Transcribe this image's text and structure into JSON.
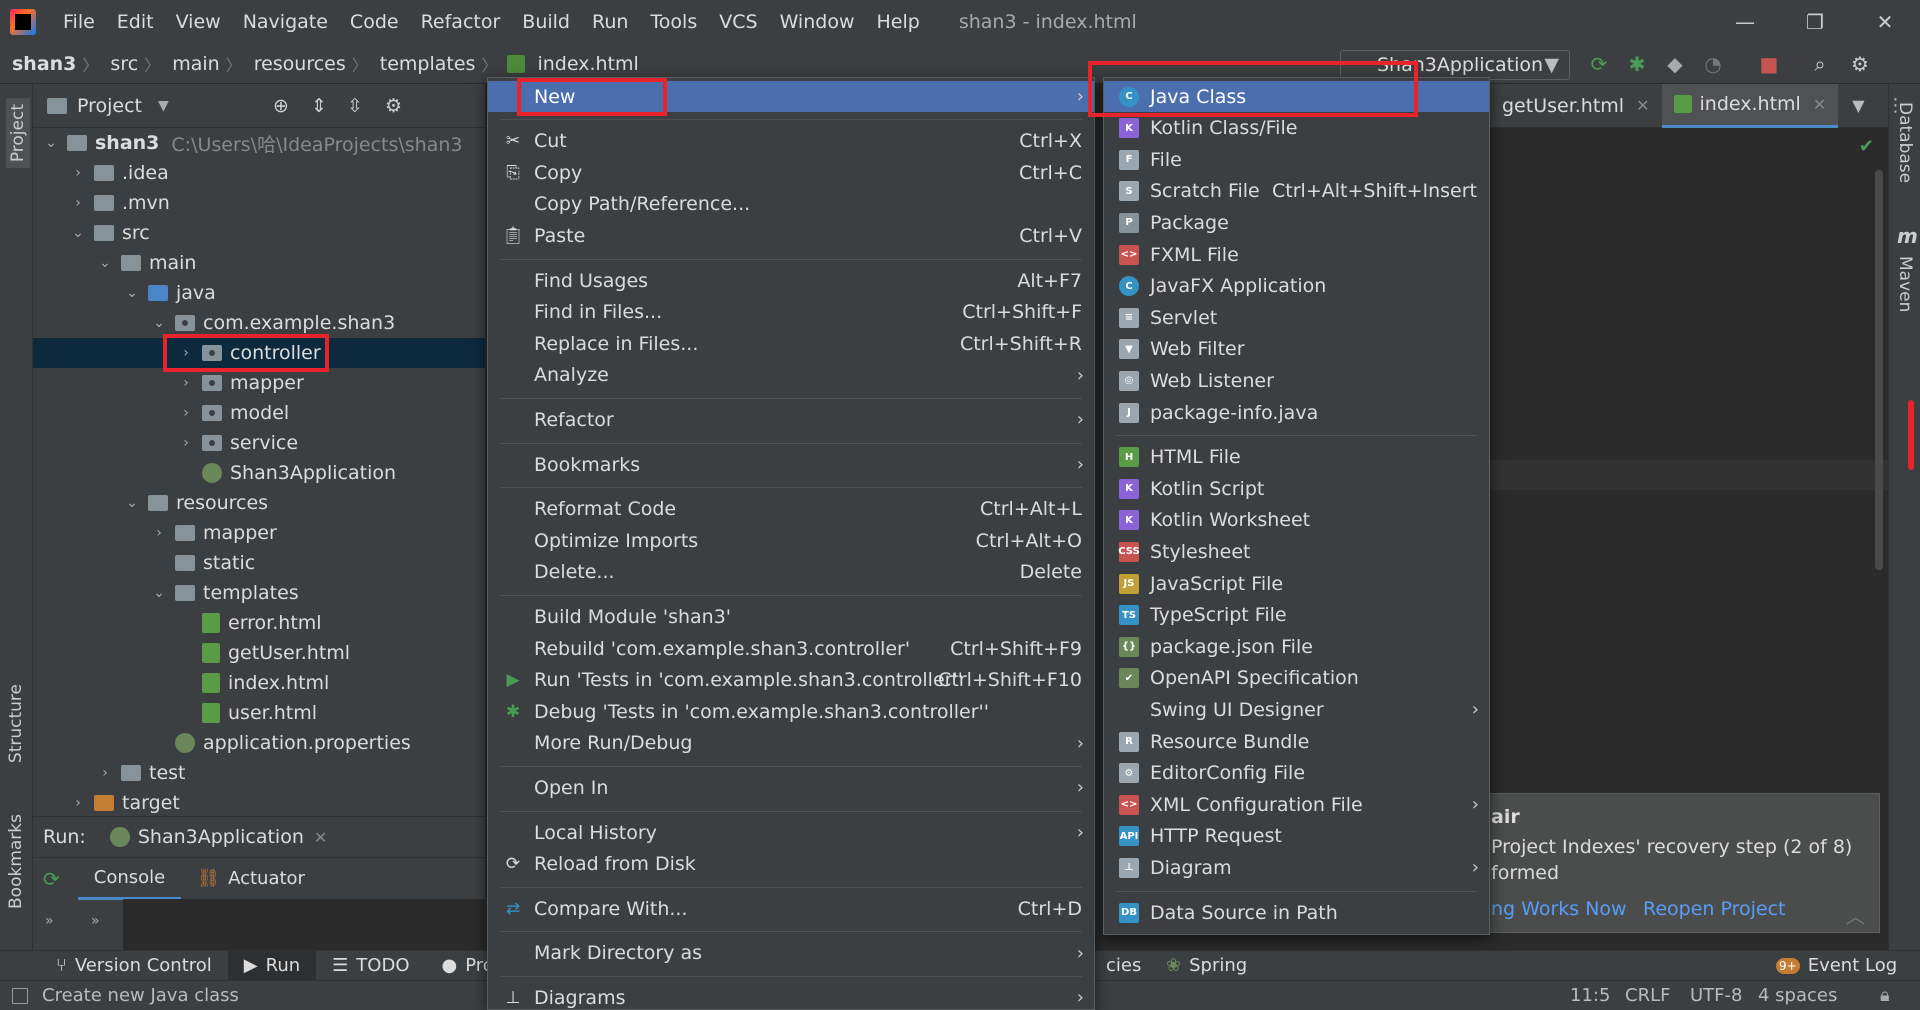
{
  "window": {
    "title": "shan3 - index.html",
    "menu": [
      "File",
      "Edit",
      "View",
      "Navigate",
      "Code",
      "Refactor",
      "Build",
      "Run",
      "Tools",
      "VCS",
      "Window",
      "Help"
    ],
    "minimize": "—",
    "restore": "❐",
    "close": "✕"
  },
  "breadcrumb": [
    "shan3",
    "src",
    "main",
    "resources",
    "templates",
    "index.html"
  ],
  "toolbar": {
    "run_config": "Shan3Application"
  },
  "left_strip": {
    "project": "Project",
    "structure": "Structure",
    "bookmarks": "Bookmarks"
  },
  "right_strip": {
    "database": "Database",
    "maven": "Maven",
    "maven_icon": "m"
  },
  "project_panel": {
    "title": "Project",
    "tree": [
      {
        "label": "shan3",
        "hint": "C:\\Users\\哈\\IdeaProjects\\shan3",
        "indent": 0,
        "chev": "down",
        "icon": "folder"
      },
      {
        "label": ".idea",
        "indent": 1,
        "chev": "right",
        "icon": "folder"
      },
      {
        "label": ".mvn",
        "indent": 1,
        "chev": "right",
        "icon": "folder"
      },
      {
        "label": "src",
        "indent": 1,
        "chev": "down",
        "icon": "folder"
      },
      {
        "label": "main",
        "indent": 2,
        "chev": "down",
        "icon": "folder"
      },
      {
        "label": "java",
        "indent": 3,
        "chev": "down",
        "icon": "folder-blue"
      },
      {
        "label": "com.example.shan3",
        "indent": 4,
        "chev": "down",
        "icon": "package"
      },
      {
        "label": "controller",
        "indent": 5,
        "chev": "right",
        "icon": "package",
        "selected": true
      },
      {
        "label": "mapper",
        "indent": 5,
        "chev": "right",
        "icon": "package"
      },
      {
        "label": "model",
        "indent": 5,
        "chev": "right",
        "icon": "package"
      },
      {
        "label": "service",
        "indent": 5,
        "chev": "right",
        "icon": "package"
      },
      {
        "label": "Shan3Application",
        "indent": 5,
        "chev": "",
        "icon": "spring"
      },
      {
        "label": "resources",
        "indent": 3,
        "chev": "down",
        "icon": "folder"
      },
      {
        "label": "mapper",
        "indent": 4,
        "chev": "right",
        "icon": "folder"
      },
      {
        "label": "static",
        "indent": 4,
        "chev": "",
        "icon": "folder"
      },
      {
        "label": "templates",
        "indent": 4,
        "chev": "down",
        "icon": "folder"
      },
      {
        "label": "error.html",
        "indent": 5,
        "chev": "",
        "icon": "html"
      },
      {
        "label": "getUser.html",
        "indent": 5,
        "chev": "",
        "icon": "html"
      },
      {
        "label": "index.html",
        "indent": 5,
        "chev": "",
        "icon": "html"
      },
      {
        "label": "user.html",
        "indent": 5,
        "chev": "",
        "icon": "html"
      },
      {
        "label": "application.properties",
        "indent": 4,
        "chev": "",
        "icon": "spring"
      },
      {
        "label": "test",
        "indent": 2,
        "chev": "right",
        "icon": "folder"
      },
      {
        "label": "target",
        "indent": 1,
        "chev": "right",
        "icon": "folder-orange"
      }
    ]
  },
  "editor_tabs": [
    {
      "label": "getUser.html",
      "active": false
    },
    {
      "label": "index.html",
      "active": true
    }
  ],
  "notification": {
    "title": "air",
    "line1": "Project Indexes' recovery step (2 of 8)",
    "line2": "formed",
    "link1": "ng Works Now",
    "link2": "Reopen Project"
  },
  "run_panel": {
    "label": "Run:",
    "config": "Shan3Application",
    "tabs": [
      "Console",
      "Actuator"
    ]
  },
  "context_menu": {
    "items": [
      {
        "label": "New",
        "shortcut": "",
        "submenu": true,
        "highlighted": true,
        "icon": ""
      },
      {
        "sep": true
      },
      {
        "label": "Cut",
        "shortcut": "Ctrl+X",
        "icon": "scissors-icon"
      },
      {
        "label": "Copy",
        "shortcut": "Ctrl+C",
        "icon": "copy-icon"
      },
      {
        "label": "Copy Path/Reference...",
        "shortcut": "",
        "icon": ""
      },
      {
        "label": "Paste",
        "shortcut": "Ctrl+V",
        "icon": "paste-icon"
      },
      {
        "sep": true
      },
      {
        "label": "Find Usages",
        "shortcut": "Alt+F7",
        "icon": ""
      },
      {
        "label": "Find in Files...",
        "shortcut": "Ctrl+Shift+F",
        "icon": ""
      },
      {
        "label": "Replace in Files...",
        "shortcut": "Ctrl+Shift+R",
        "icon": ""
      },
      {
        "label": "Analyze",
        "submenu": true,
        "icon": ""
      },
      {
        "sep": true
      },
      {
        "label": "Refactor",
        "submenu": true,
        "icon": ""
      },
      {
        "sep": true
      },
      {
        "label": "Bookmarks",
        "submenu": true,
        "icon": ""
      },
      {
        "sep": true
      },
      {
        "label": "Reformat Code",
        "shortcut": "Ctrl+Alt+L",
        "icon": ""
      },
      {
        "label": "Optimize Imports",
        "shortcut": "Ctrl+Alt+O",
        "icon": ""
      },
      {
        "label": "Delete...",
        "shortcut": "Delete",
        "icon": ""
      },
      {
        "sep": true
      },
      {
        "label": "Build Module 'shan3'",
        "shortcut": "",
        "icon": ""
      },
      {
        "label": "Rebuild 'com.example.shan3.controller'",
        "shortcut": "Ctrl+Shift+F9",
        "icon": ""
      },
      {
        "label": "Run 'Tests in 'com.example.shan3.controller''",
        "shortcut": "Ctrl+Shift+F10",
        "icon": "run-icon"
      },
      {
        "label": "Debug 'Tests in 'com.example.shan3.controller''",
        "shortcut": "",
        "icon": "debug-icon"
      },
      {
        "label": "More Run/Debug",
        "submenu": true,
        "icon": ""
      },
      {
        "sep": true
      },
      {
        "label": "Open In",
        "submenu": true,
        "icon": ""
      },
      {
        "sep": true
      },
      {
        "label": "Local History",
        "submenu": true,
        "icon": ""
      },
      {
        "label": "Reload from Disk",
        "shortcut": "",
        "icon": "reload-icon"
      },
      {
        "sep": true
      },
      {
        "label": "Compare With...",
        "shortcut": "Ctrl+D",
        "icon": "compare-icon"
      },
      {
        "sep": true
      },
      {
        "label": "Mark Directory as",
        "submenu": true,
        "icon": ""
      },
      {
        "sep": true
      },
      {
        "label": "Diagrams",
        "submenu": true,
        "icon": "diagram-icon"
      }
    ]
  },
  "new_submenu": {
    "items": [
      {
        "label": "Java Class",
        "icon": "C",
        "color": "#3592c4",
        "highlighted": true
      },
      {
        "label": "Kotlin Class/File",
        "icon": "K",
        "color": "#8a64d6"
      },
      {
        "label": "File",
        "icon": "F",
        "color": "#9aa7b0"
      },
      {
        "label": "Scratch File",
        "shortcut": "Ctrl+Alt+Shift+Insert",
        "icon": "S",
        "color": "#9aa7b0"
      },
      {
        "label": "Package",
        "icon": "P",
        "color": "#87939a"
      },
      {
        "label": "FXML File",
        "icon": "<>",
        "color": "#c75450"
      },
      {
        "label": "JavaFX Application",
        "icon": "C",
        "color": "#3592c4"
      },
      {
        "label": "Servlet",
        "icon": "≡",
        "color": "#9aa7b0"
      },
      {
        "label": "Web Filter",
        "icon": "▼",
        "color": "#9aa7b0"
      },
      {
        "label": "Web Listener",
        "icon": "◎",
        "color": "#9aa7b0"
      },
      {
        "label": "package-info.java",
        "icon": "J",
        "color": "#9aa7b0"
      },
      {
        "sep": true
      },
      {
        "label": "HTML File",
        "icon": "H",
        "color": "#5b9a46"
      },
      {
        "label": "Kotlin Script",
        "icon": "K",
        "color": "#8a64d6"
      },
      {
        "label": "Kotlin Worksheet",
        "icon": "K",
        "color": "#8a64d6"
      },
      {
        "label": "Stylesheet",
        "icon": "CSS",
        "color": "#c75450"
      },
      {
        "label": "JavaScript File",
        "icon": "JS",
        "color": "#c0a034"
      },
      {
        "label": "TypeScript File",
        "icon": "TS",
        "color": "#3592c4"
      },
      {
        "label": "package.json File",
        "icon": "{}",
        "color": "#6a8759"
      },
      {
        "label": "OpenAPI Specification",
        "icon": "✔",
        "color": "#6a8759"
      },
      {
        "label": "Swing UI Designer",
        "submenu": true,
        "icon": "",
        "color": ""
      },
      {
        "label": "Resource Bundle",
        "icon": "R",
        "color": "#9aa7b0"
      },
      {
        "label": "EditorConfig File",
        "icon": "⚙",
        "color": "#9aa7b0"
      },
      {
        "label": "XML Configuration File",
        "submenu": true,
        "icon": "<>",
        "color": "#c75450"
      },
      {
        "label": "HTTP Request",
        "icon": "API",
        "color": "#3592c4"
      },
      {
        "label": "Diagram",
        "submenu": true,
        "icon": "⊥",
        "color": "#9aa7b0"
      },
      {
        "sep": true
      },
      {
        "label": "Data Source in Path",
        "icon": "DB",
        "color": "#3592c4"
      }
    ]
  },
  "bottom_tools": [
    {
      "label": "Version Control",
      "icon": "⑂"
    },
    {
      "label": "Run",
      "icon": "▶",
      "active": true
    },
    {
      "label": "TODO",
      "icon": "☰"
    },
    {
      "label": "Proble",
      "icon": "●"
    },
    {
      "label": "cies",
      "icon": ""
    },
    {
      "label": "Spring",
      "icon": "❀"
    },
    {
      "label": "Event Log",
      "icon": "9+"
    }
  ],
  "statusbar": {
    "message": "Create new Java class",
    "position": "11:5",
    "line_sep": "CRLF",
    "encoding": "UTF-8",
    "indent": "4 spaces"
  },
  "colors": {
    "accent": "#4b6eaf",
    "selection": "#0d293e",
    "annotation": "#e8232b"
  }
}
